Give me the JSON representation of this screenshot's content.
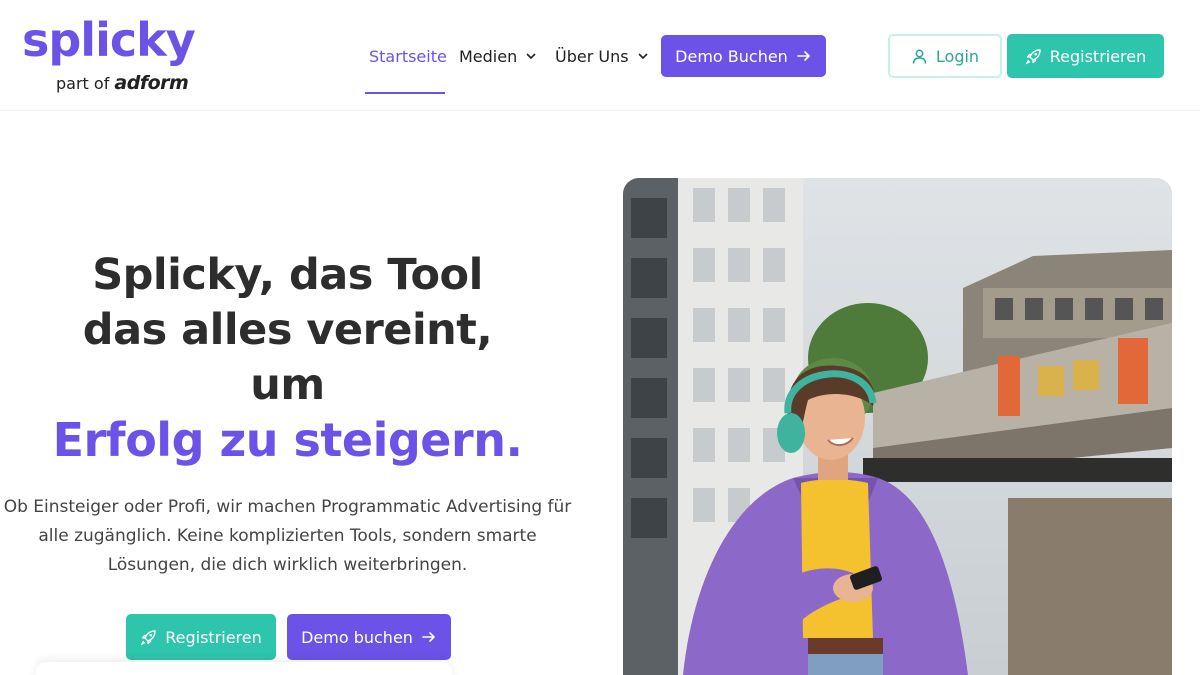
{
  "brand": {
    "logo_text": "splicky",
    "sub_prefix": "part of",
    "sub_brand": "adform"
  },
  "nav": {
    "items": [
      {
        "label": "Startseite",
        "active": true
      },
      {
        "label": "Medien",
        "has_dropdown": true
      },
      {
        "label": "Über Uns",
        "has_dropdown": true
      }
    ],
    "demo_button": "Demo Buchen",
    "login_button": "Login",
    "register_button": "Registrieren"
  },
  "hero": {
    "title_lines": [
      "Splicky, das Tool",
      "das alles vereint,",
      "um"
    ],
    "title_accent": "Erfolg zu steigern.",
    "description": "Ob Einsteiger oder Profi, wir machen Programmatic Advertising für alle zugänglich. Keine komplizierten Tools, sondern smarte Lösungen, die dich wirklich weiterbringen.",
    "register_button": "Registrieren",
    "demo_button": "Demo buchen"
  },
  "colors": {
    "primary": "#6c52e6",
    "teal": "#2dc5ac",
    "text": "#2d2d2d"
  },
  "icons": {
    "arrow": "arrow-right-icon",
    "rocket": "rocket-icon",
    "user": "user-icon",
    "chevron": "chevron-down-icon"
  }
}
